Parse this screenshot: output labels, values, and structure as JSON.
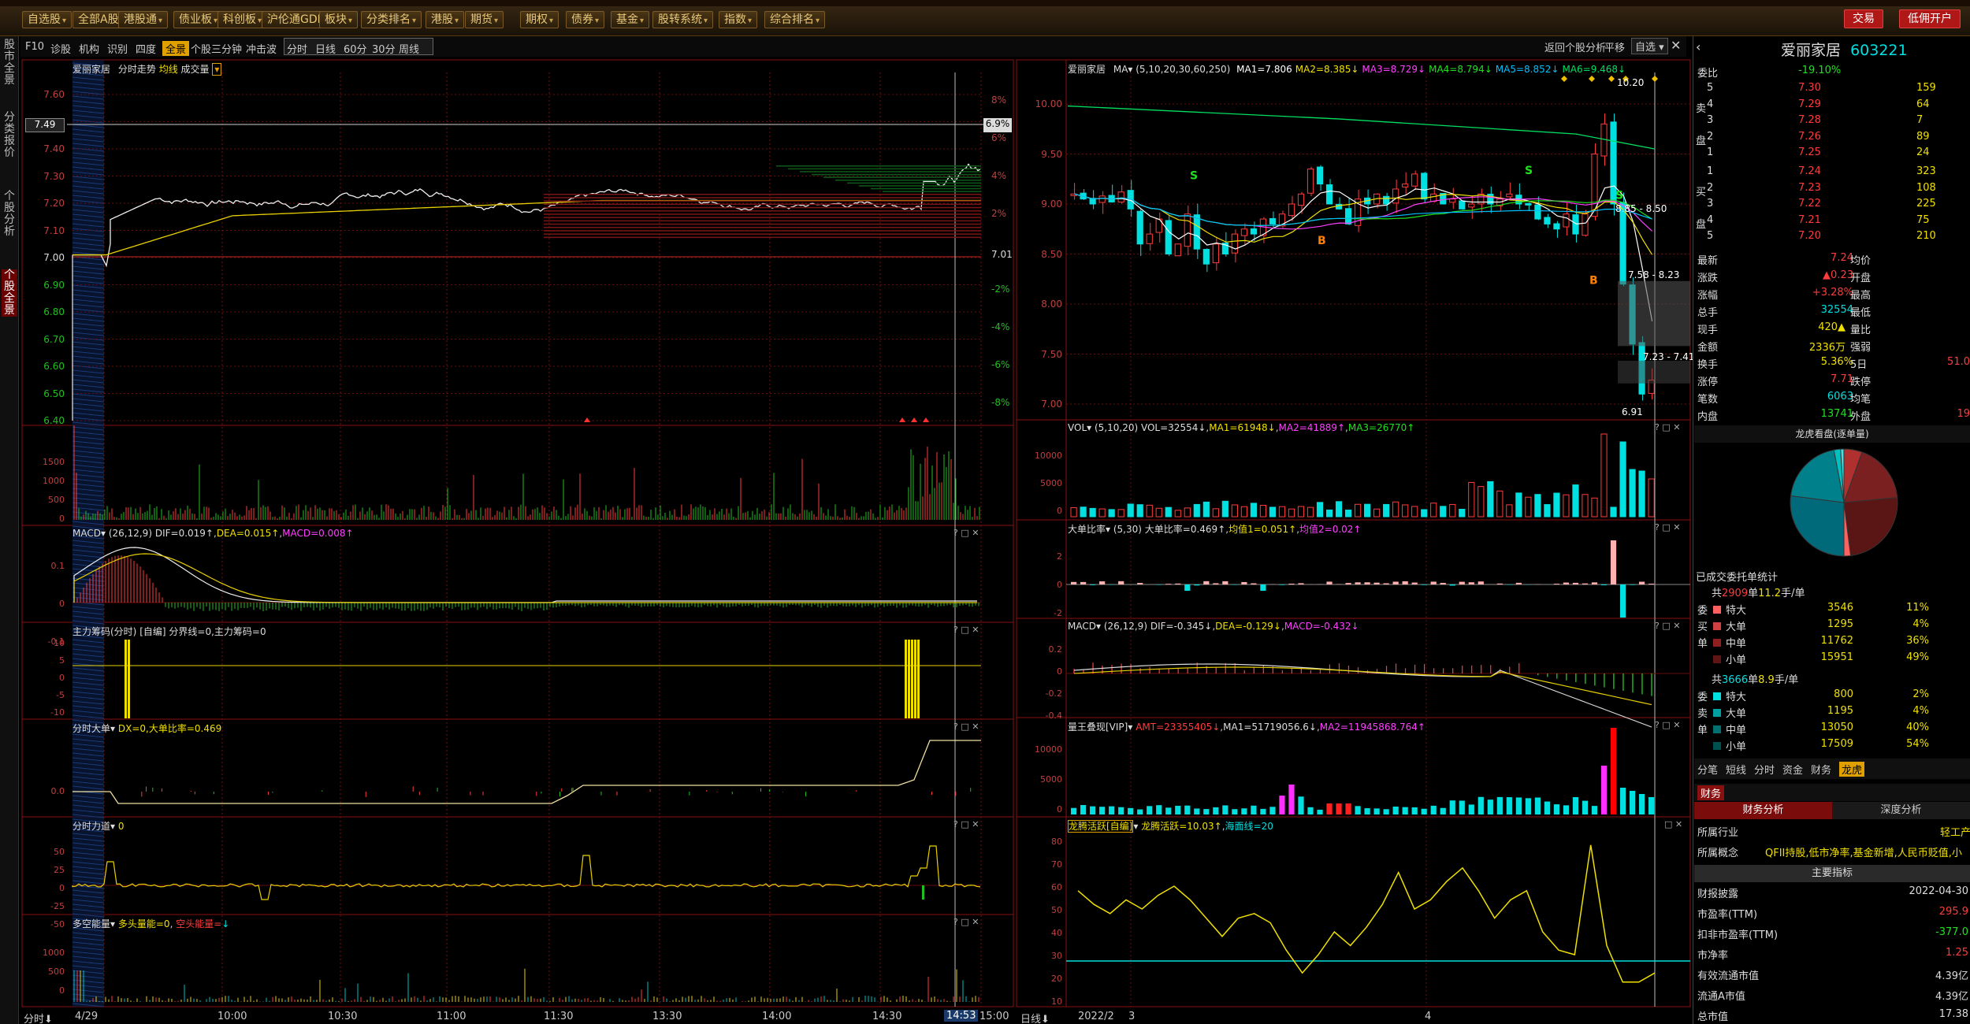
{
  "toolbar": {
    "items": [
      "自选股",
      "全部A股",
      "港股通",
      "债业板",
      "科创板",
      "沪伦通GDR",
      "板块",
      "分类排名",
      "港股",
      "期货",
      "期权",
      "债券",
      "基金",
      "股转系统",
      "指数",
      "综合排名"
    ],
    "trade": "交易",
    "open_account": "低佣开户"
  },
  "left_strip": {
    "tabs": [
      "股市全景",
      "分类报价",
      "个股分析",
      "个股全景"
    ]
  },
  "left_tabs": {
    "items": [
      "F10",
      "诊股",
      "机构",
      "识别",
      "四度",
      "全景",
      "个股三分钟",
      "冲击波"
    ],
    "period": [
      "分时",
      "日线",
      "60分",
      "30分",
      "周线"
    ]
  },
  "right_tabs": {
    "back": "返回个股分析",
    "ping": "平移",
    "zixuan": "自选"
  },
  "intraday": {
    "name": "爱丽家居",
    "title": "分时走势",
    "avg_label": "均线",
    "vol_label": "成交量",
    "y_labels": [
      "7.60",
      "7.50",
      "7.40",
      "7.30",
      "7.20",
      "7.10",
      "7.00",
      "6.90",
      "6.80",
      "6.70",
      "6.60",
      "6.50",
      "6.40"
    ],
    "pct_labels": [
      "8%",
      "6%",
      "4%",
      "2%",
      "",
      "-2%",
      "-4%",
      "-6%",
      "-8%"
    ],
    "cur_price": "7.49",
    "cur_pct": "6.9%",
    "mid_price": "7.01",
    "vol_labels": [
      "1500",
      "1000",
      "500",
      "0"
    ],
    "macd_head": {
      "name": "MACD",
      "params": "(26,12,9)",
      "dif": "DIF=0.019↑",
      "dea": "DEA=0.015↑",
      "macd": "MACD=0.008↑"
    },
    "macd_labels": [
      "0.1",
      "0",
      "-0.1"
    ],
    "zhuli_head": {
      "name": "主力筹码(分时)",
      "tag": "[自编]",
      "value": "分界线=0,主力筹码=0"
    },
    "zhuli_labels": [
      "10",
      "5",
      "0",
      "-5",
      "-10"
    ],
    "dadan_head": {
      "name": "分时大单",
      "value": "DX=0,大单比率=0.469"
    },
    "dadan_labels": [
      "0.0"
    ],
    "lidao_head": {
      "name": "分时力道",
      "value": "0"
    },
    "lidao_labels": [
      "50",
      "25",
      "0",
      "-25",
      "-50"
    ],
    "duokong_head": {
      "name": "多空能量",
      "v1": "多头量能=0",
      "v2": "空头能量=",
      "v3": "↓"
    },
    "duokong_labels": [
      "1000",
      "500",
      "0"
    ],
    "x_labels": [
      "4/29",
      "10:00",
      "10:30",
      "11:00",
      "11:30",
      "13:30",
      "14:00",
      "14:30",
      "14:53",
      "15:00"
    ],
    "xaxis_btn": "分时"
  },
  "kline": {
    "name": "爱丽家居",
    "ma_btn": "MA",
    "ma_params": "(5,10,20,30,60,250)",
    "ma": [
      {
        "label": "MA1=7.806",
        "color": "#ffffff"
      },
      {
        "label": "MA2=8.385↓",
        "color": "#f0e000"
      },
      {
        "label": "MA3=8.729↓",
        "color": "#ff40ff"
      },
      {
        "label": "MA4=8.794↓",
        "color": "#20e020"
      },
      {
        "label": "MA5=8.852↓",
        "color": "#00c0ff"
      },
      {
        "label": "MA6=9.468↓",
        "color": "#00e060"
      }
    ],
    "y_labels": [
      "10.00",
      "9.50",
      "9.00",
      "8.50",
      "8.00",
      "7.50",
      "7.00"
    ],
    "annotations": [
      "10.20",
      "8.85 - 8.50",
      "7.58 - 8.23",
      "7.23 - 7.41",
      "6.91"
    ],
    "vol_head": {
      "name": "VOL",
      "params": "(5,10,20)",
      "v": "VOL=32554↓",
      "ma1": "MA1=61948↓",
      "ma2": "MA2=41889↑",
      "ma3": "MA3=26770↑"
    },
    "vol_labels": [
      "10000",
      "5000",
      "0"
    ],
    "dadan_head": {
      "name": "大单比率",
      "params": "(5,30)",
      "v": "大单比率=0.469↑",
      "j1": "均值1=0.051↑",
      "j2": "均值2=0.02↑"
    },
    "dadan_labels": [
      "2",
      "0",
      "-2"
    ],
    "macd_head": {
      "name": "MACD",
      "params": "(26,12,9)",
      "dif": "DIF=-0.345↓",
      "dea": "DEA=-0.129↓",
      "macd": "MACD=-0.432↓"
    },
    "macd_labels": [
      "0.2",
      "0",
      "-0.2",
      "-0.4"
    ],
    "lw_head": {
      "name": "量王叠现[VIP]",
      "amt": "AMT=23355405↓",
      "ma1": "MA1=51719056.6↓",
      "ma2": "MA2=11945868.764↑"
    },
    "lw_labels": [
      "10000",
      "5000",
      "0"
    ],
    "lt_head": {
      "name": "龙腾活跃[自编]",
      "v": "龙腾活跃=10.03↑",
      "h": "海面线=20"
    },
    "lt_labels": [
      "80",
      "70",
      "60",
      "50",
      "40",
      "30",
      "20",
      "10"
    ],
    "x_labels": [
      "2022/2",
      "3",
      "4"
    ],
    "xaxis_btn": "日线"
  },
  "quote": {
    "name": "爱丽家居",
    "code": "603221",
    "weibi_label": "委比",
    "weibi": "-19.10%",
    "sells": [
      {
        "lv": "5",
        "p": "7.30",
        "v": "159"
      },
      {
        "lv": "4",
        "p": "7.29",
        "v": "64"
      },
      {
        "lv": "3",
        "p": "7.28",
        "v": "7"
      },
      {
        "lv": "2",
        "p": "7.26",
        "v": "89"
      },
      {
        "lv": "1",
        "p": "7.25",
        "v": "24"
      }
    ],
    "buys": [
      {
        "lv": "1",
        "p": "7.24",
        "v": "323"
      },
      {
        "lv": "2",
        "p": "7.23",
        "v": "108"
      },
      {
        "lv": "3",
        "p": "7.22",
        "v": "225"
      },
      {
        "lv": "4",
        "p": "7.21",
        "v": "75"
      },
      {
        "lv": "5",
        "p": "7.20",
        "v": "210"
      }
    ],
    "sell_tag": "卖",
    "buy_tag": "买",
    "pan_tag": "盘",
    "stats": [
      {
        "k": "最新",
        "v": "7.24",
        "vc": "red",
        "k2": "均价",
        "v2": ""
      },
      {
        "k": "涨跌",
        "v": "▲0.23",
        "vc": "red",
        "k2": "开盘",
        "v2": ""
      },
      {
        "k": "涨幅",
        "v": "+3.28%",
        "vc": "red",
        "k2": "最高",
        "v2": ""
      },
      {
        "k": "总手",
        "v": "32554",
        "vc": "cyn",
        "k2": "最低",
        "v2": ""
      },
      {
        "k": "现手",
        "v": "420▲",
        "vc": "yel",
        "k2": "量比",
        "v2": ""
      },
      {
        "k": "金额",
        "v": "2336万",
        "vc": "yel",
        "k2": "强弱",
        "v2": ""
      },
      {
        "k": "换手",
        "v": "5.36%",
        "vc": "yel",
        "k2": "5日",
        "v2": "51.0"
      },
      {
        "k": "涨停",
        "v": "7.71",
        "vc": "red",
        "k2": "跌停",
        "v2": ""
      },
      {
        "k": "笔数",
        "v": "6063",
        "vc": "cyn",
        "k2": "均笔",
        "v2": ""
      },
      {
        "k": "内盘",
        "v": "13741",
        "vc": "grn",
        "k2": "外盘",
        "v2": "19"
      }
    ],
    "longhu_title": "龙虎看盘(逐单量)",
    "pie": [
      {
        "name": "buy-large",
        "value": 11,
        "color": "#b03030"
      },
      {
        "name": "buy-mid",
        "value": 36,
        "color": "#7a2020"
      },
      {
        "name": "buy-small",
        "value": 49,
        "color": "#5a1515"
      },
      {
        "name": "buy-super",
        "value": 4,
        "color": "#ff6060"
      },
      {
        "name": "sell-small",
        "value": 54,
        "color": "#006a7a"
      },
      {
        "name": "sell-mid",
        "value": 40,
        "color": "#00808a"
      },
      {
        "name": "sell-large",
        "value": 4,
        "color": "#00c0c0"
      },
      {
        "name": "sell-super",
        "value": 2,
        "color": "#40e0e0"
      }
    ],
    "deal_title": "已成交委托单统计",
    "buy_total": {
      "pre": "共",
      "n": "2909",
      "mid": "单",
      "hand": "11.2",
      "post": "手/单"
    },
    "buy_rows": [
      {
        "name": "特大",
        "v": "3546",
        "p": "11%",
        "color": "#ff6060"
      },
      {
        "name": "大单",
        "v": "1295",
        "p": "4%",
        "color": "#d04040"
      },
      {
        "name": "中单",
        "v": "11762",
        "p": "36%",
        "color": "#902020"
      },
      {
        "name": "小单",
        "v": "15951",
        "p": "49%",
        "color": "#601515"
      }
    ],
    "buy_side": [
      "委",
      "买",
      "单"
    ],
    "sell_total": {
      "pre": "共",
      "n": "3666",
      "mid": "单",
      "hand": "8.9",
      "post": "手/单"
    },
    "sell_rows": [
      {
        "name": "特大",
        "v": "800",
        "p": "2%",
        "color": "#00e0e0"
      },
      {
        "name": "大单",
        "v": "1195",
        "p": "4%",
        "color": "#00a0a0"
      },
      {
        "name": "中单",
        "v": "13050",
        "p": "40%",
        "color": "#007070"
      },
      {
        "name": "小单",
        "v": "17509",
        "p": "54%",
        "color": "#005050"
      }
    ],
    "sell_side": [
      "委",
      "卖",
      "单"
    ],
    "subtabs": [
      "分笔",
      "短线",
      "分时",
      "资金",
      "财务",
      "龙虎"
    ],
    "fin_tab": "财务",
    "fin_sub": [
      "财务分析",
      "深度分析"
    ],
    "industry": {
      "k": "所属行业",
      "v": "轻工产"
    },
    "concept": {
      "k": "所属概念",
      "v": "QFII持股,低市净率,基金新增,人民币贬值,小"
    },
    "main_title": "主要指标",
    "fin_rows": [
      {
        "k": "财报披露",
        "v": "2022-04-30",
        "c": "wht"
      },
      {
        "k": "市盈率(TTM)",
        "v": "295.9",
        "c": "red"
      },
      {
        "k": "扣非市盈率(TTM)",
        "v": "-377.0",
        "c": "grn"
      },
      {
        "k": "市净率",
        "v": "1.25",
        "c": "red"
      },
      {
        "k": "有效流通市值",
        "v": "4.39亿",
        "c": "wht"
      },
      {
        "k": "流通A市值",
        "v": "4.39亿",
        "c": "wht"
      },
      {
        "k": "总市值",
        "v": "17.38",
        "c": "wht"
      }
    ]
  },
  "colors": {
    "up": "#ff3c3c",
    "down": "#00e0e0",
    "panel_border": "#8a1010",
    "bg": "#000000",
    "accent": "#e0a000"
  }
}
